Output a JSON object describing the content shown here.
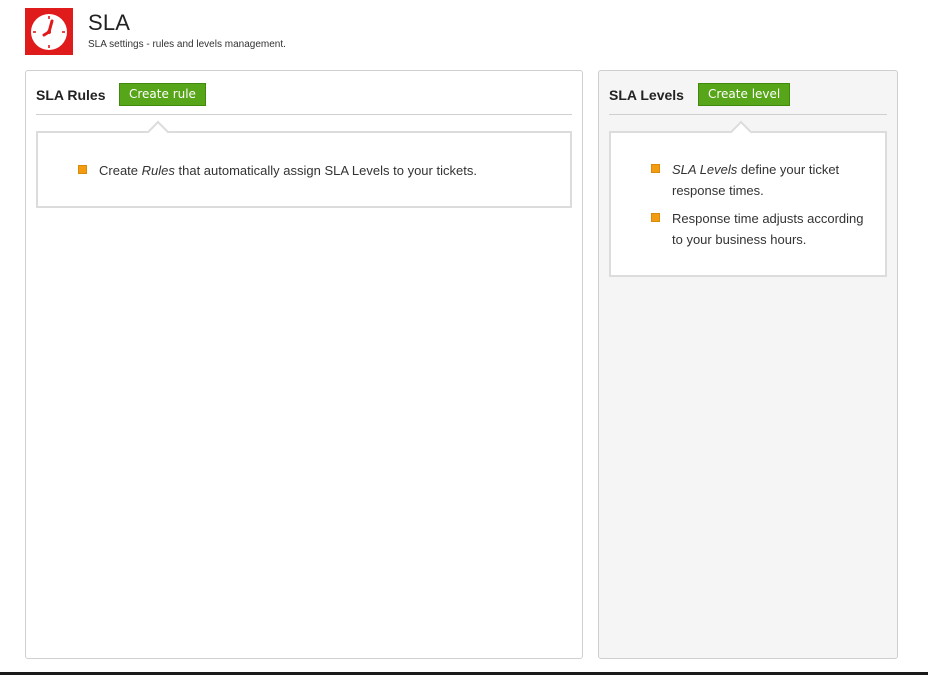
{
  "header": {
    "title": "SLA",
    "subtitle": "SLA settings - rules and levels management.",
    "logo_icon": "clock-icon",
    "logo_color": "#e01b1b"
  },
  "rules": {
    "title": "SLA Rules",
    "create_button": "Create rule",
    "bullet_1_pre": "Create ",
    "bullet_1_em": "Rules",
    "bullet_1_post": " that automatically assign SLA Levels to your tickets."
  },
  "levels": {
    "title": "SLA Levels",
    "create_button": "Create level",
    "bullet_1_em": "SLA Levels",
    "bullet_1_post": " define your ticket response times.",
    "bullet_2": "Response time adjusts according to your business hours."
  },
  "colors": {
    "button_green": "#57a518",
    "bullet_orange": "#f39c12"
  }
}
